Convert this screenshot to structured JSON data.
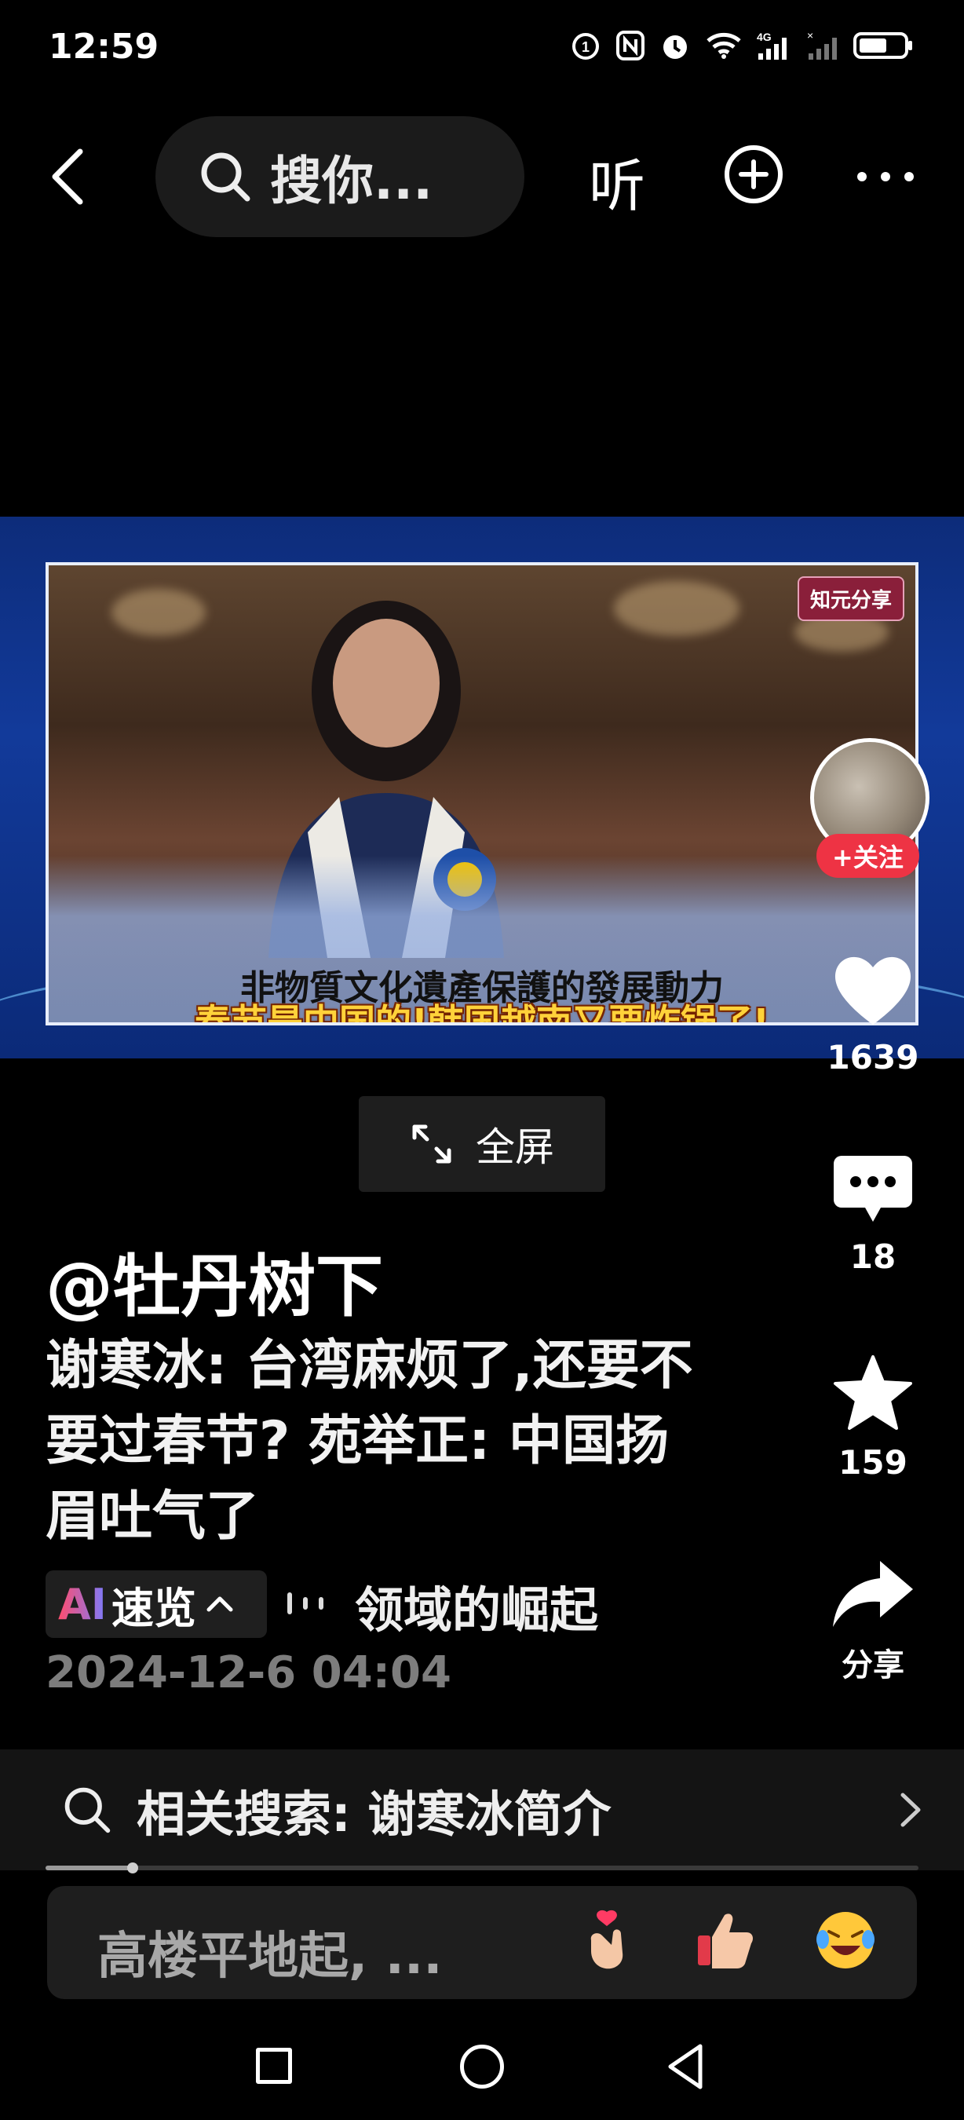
{
  "status_bar": {
    "time": "12:59",
    "icons": [
      "alarm-icon",
      "nfc-icon",
      "do-not-disturb-icon",
      "wifi-icon",
      "signal-4g-icon",
      "signal-icon",
      "battery-icon"
    ]
  },
  "top_bar": {
    "search_placeholder": "搜你...",
    "listen_label": "听"
  },
  "video": {
    "badge": "知元分享",
    "subtitle_line1": "非物質文化遺產保護的發展動力",
    "subtitle_line2": "春节是中国的!韩国越南又要炸锅了!",
    "fullscreen_label": "全屏"
  },
  "actions": {
    "follow_label": "+关注",
    "like_count": "1639",
    "comment_count": "18",
    "collect_count": "159",
    "share_label": "分享"
  },
  "post": {
    "author": "@牡丹树下",
    "title": "谢寒冰: 台湾麻烦了,还要不要过春节? 苑举正: 中国扬眉吐气了",
    "ai_prefix": "AI",
    "ai_label": "速览",
    "summary_text": "领域的崛起",
    "date": "2024-12-6 04:04"
  },
  "related": {
    "label": "相关搜索: 谢寒冰简介"
  },
  "progress": {
    "fraction": 0.1
  },
  "comment_bar": {
    "placeholder": "高楼平地起, ..."
  },
  "colors": {
    "background": "#000000",
    "follow_button": "#ee3344",
    "subtitle_yellow": "#ffd23a",
    "date_gray": "#7d7d7d"
  }
}
